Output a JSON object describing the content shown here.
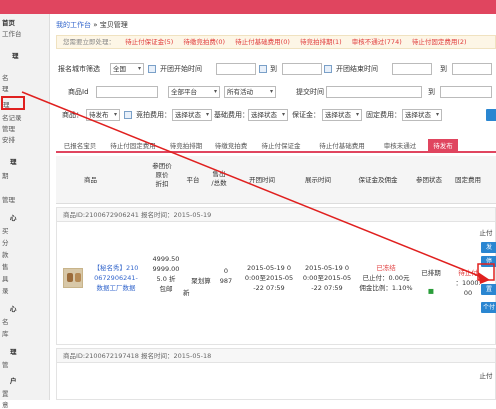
{
  "sidebar": {
    "items": [
      "首页",
      "工作台",
      "理",
      "名",
      "理",
      "名记录",
      "管理",
      "安排",
      "理",
      "期",
      "管理",
      "心",
      "买",
      "分",
      "款",
      "售",
      "具",
      "录",
      "心",
      "名",
      "库",
      "理",
      "管",
      "户",
      "置",
      "意"
    ]
  },
  "breadcrumb": {
    "home": "我的工作台",
    "sep": "»",
    "current": "宝贝管理"
  },
  "alert": {
    "prefix": "您需要立即处理：",
    "items": [
      "待止付保证金(5)",
      "待缴竞拍费(0)",
      "待止付基础费用(0)",
      "待竞拍排期(1)",
      "审核不通过(774)",
      "待止付固定费用(2)"
    ]
  },
  "filters": {
    "city_label": "报名城市筛选",
    "city_value": "全国",
    "open_start_label": "开团开始时间",
    "to1": "到",
    "open_end_label": "开团结束时间",
    "to2": "到",
    "product_id_label": "商品Id",
    "platform_value": "全部平台",
    "activity_value": "所有活动",
    "submit_time_label": "提交时间",
    "to3": "到",
    "product_label": "商品：",
    "product_value": "待发布",
    "bid_fee_label": "竞拍费用：",
    "bid_fee_value": "选择状态",
    "base_fee_label": "基础费用：",
    "base_fee_value": "选择状态",
    "deposit_label": "保证金：",
    "deposit_value": "选择状态",
    "fixed_fee_label": "固定费用：",
    "fixed_fee_value": "选择状态"
  },
  "tabs": [
    "已报名宝贝",
    "待止付固定费用",
    "待竞拍排期",
    "待缴竞拍费",
    "待止付保证金",
    "待止付基础费用",
    "审核未通过",
    "待发布"
  ],
  "table_headers": {
    "product": "商品",
    "price": [
      "参团价",
      "原价",
      "折扣"
    ],
    "platform": "平台",
    "sold": [
      "售出",
      "/总数"
    ],
    "open_time": "开团时间",
    "show_time": "展示时间",
    "deposit": "保证金及佣金",
    "status": "参团状态",
    "fixed_fee": "固定费用"
  },
  "rows": [
    {
      "header": "商品ID:2100672906241 报名时间：2015-05-19",
      "name": "【秘名秀】2100672906241-数据工厂数据",
      "name_lines": [
        "【秘名秀】210",
        "0672906241-",
        "数据工厂数据"
      ],
      "price_lines": [
        "4999.50",
        "9999.00",
        "5.0 折",
        "包邮"
      ],
      "price_tail": "新",
      "platform": "聚划算",
      "sold_lines": [
        "0",
        "987"
      ],
      "open_time_lines": [
        "2015-05-19 0",
        "0:00至2015-05",
        "-22 07:59"
      ],
      "show_time_lines": [
        "2015-05-19 0",
        "0:00至2015-05",
        "-22 07:59"
      ],
      "deposit_status": "已冻结",
      "deposit_paid": "已止付：0.00元",
      "commission": "佣金比例：1.10%",
      "status": "已排期",
      "fixed_fee_status": "待止付",
      "fixed_fee_amount": "：1000.",
      "fixed_fee_tail": "00",
      "actions": [
        "止付",
        "发",
        "停",
        "置",
        "个付"
      ]
    },
    {
      "header": "商品ID:2100672197418 报名时间：2015-05-18",
      "actions": [
        "止付"
      ]
    }
  ]
}
